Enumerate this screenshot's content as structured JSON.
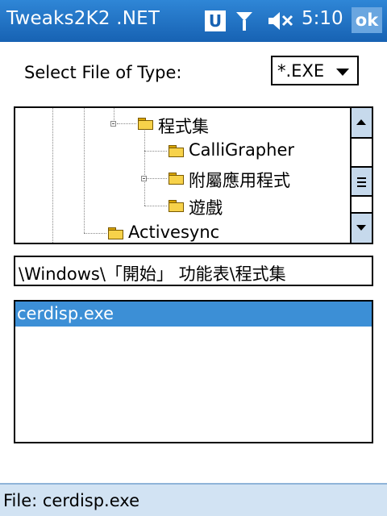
{
  "titlebar": {
    "title": "Tweaks2K2 .NET",
    "u_badge": "U",
    "clock": "5:10",
    "ok_label": "ok",
    "icons": [
      "u-badge-icon",
      "antenna-signal-icon",
      "speaker-muted-icon"
    ]
  },
  "select": {
    "label": "Select File of Type:",
    "value": "*.EXE"
  },
  "tree": {
    "items": [
      {
        "label": "程式集",
        "expanded": true
      },
      {
        "label": "CalliGrapher"
      },
      {
        "label": "附屬應用程式",
        "expanded": false
      },
      {
        "label": "遊戲"
      },
      {
        "label": "Activesync"
      }
    ]
  },
  "path": {
    "value": "\\Windows\\「開始」 功能表\\程式集"
  },
  "files": {
    "items": [
      {
        "name": "cerdisp.exe",
        "selected": true
      }
    ]
  },
  "status": {
    "text": "File: cerdisp.exe"
  },
  "colors": {
    "titlebar": "#1762b3",
    "selection": "#3c8fd6",
    "statusbar": "#d2e3f3",
    "scroll_button": "#c6d9ec"
  }
}
